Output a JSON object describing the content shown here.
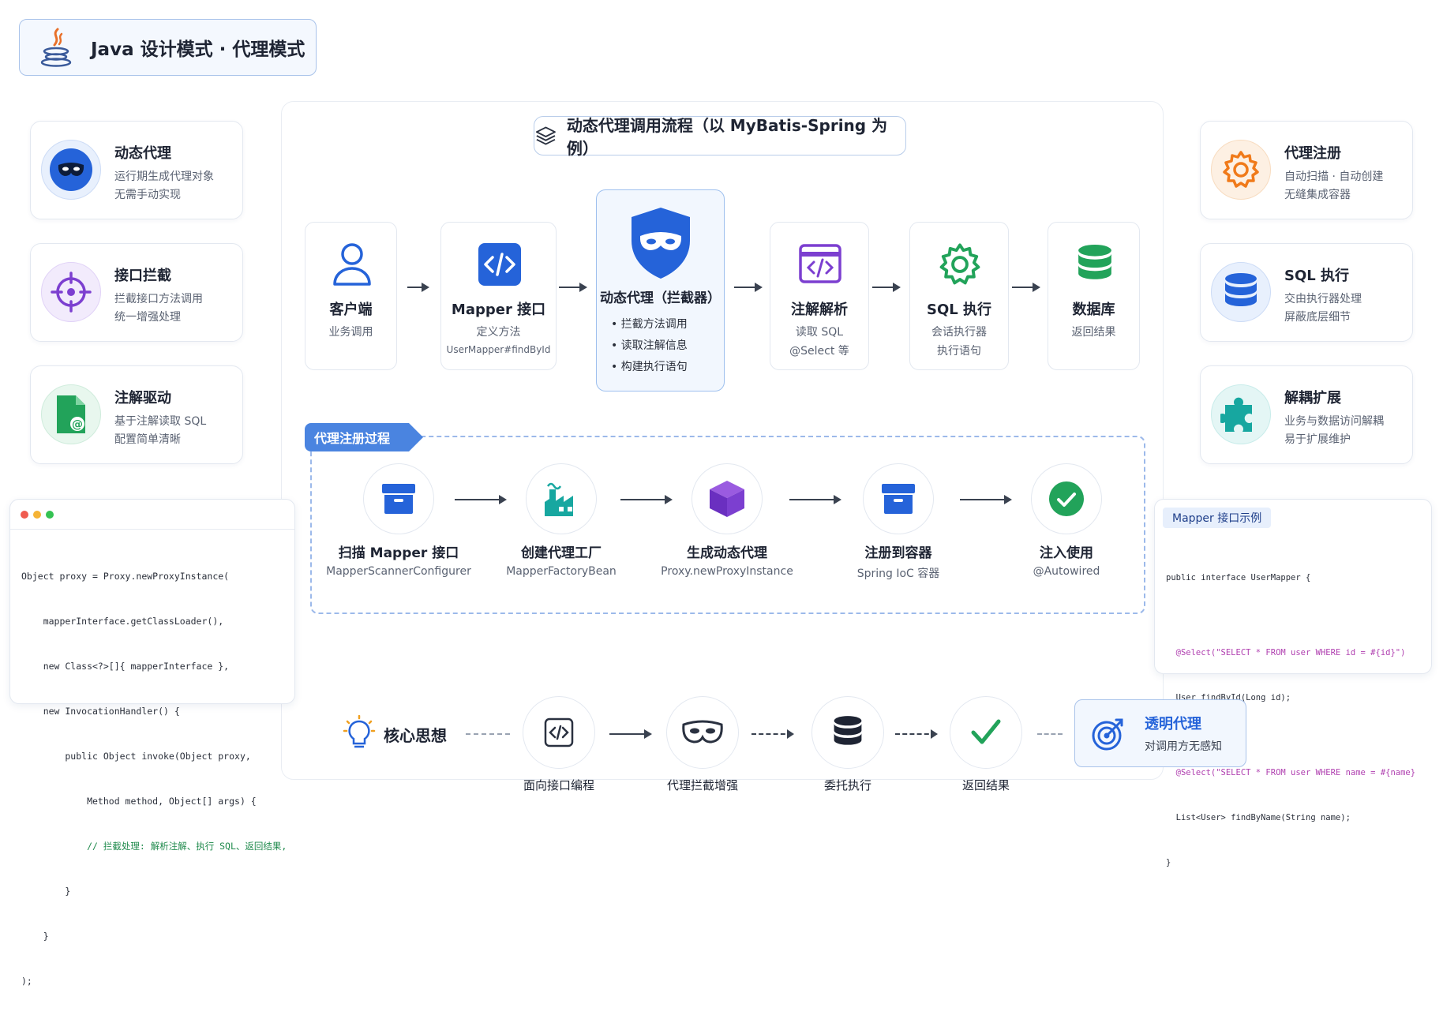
{
  "title": "Java 设计模式 · 代理模式",
  "section_title": "动态代理调用流程（以 MyBatis-Spring 为例）",
  "left_features": [
    {
      "title": "动态代理",
      "line1": "运行期生成代理对象",
      "line2": "无需手动实现",
      "icon": "mask-icon",
      "color": "#2563d9"
    },
    {
      "title": "接口拦截",
      "line1": "拦截接口方法调用",
      "line2": "统一增强处理",
      "icon": "crosshair-icon",
      "color": "#7c3fd0"
    },
    {
      "title": "注解驱动",
      "line1": "基于注解读取 SQL",
      "line2": "配置简单清晰",
      "icon": "annotation-file-icon",
      "color": "#22a35a"
    }
  ],
  "right_features": [
    {
      "title": "代理注册",
      "line1": "自动扫描 · 自动创建",
      "line2": "无缝集成容器",
      "icon": "gear-icon",
      "color": "#f07a1a"
    },
    {
      "title": "SQL 执行",
      "line1": "交由执行器处理",
      "line2": "屏蔽底层细节",
      "icon": "database-icon",
      "color": "#2563d9"
    },
    {
      "title": "解耦扩展",
      "line1": "业务与数据访问解耦",
      "line2": "易于扩展维护",
      "icon": "puzzle-icon",
      "color": "#17a7a0"
    }
  ],
  "flow": [
    {
      "title": "客户端",
      "desc": "业务调用",
      "sub": ""
    },
    {
      "title": "Mapper 接口",
      "desc": "定义方法",
      "sub": "UserMapper#findById"
    },
    {
      "title": "动态代理（拦截器）",
      "bullets": [
        "拦截方法调用",
        "读取注解信息",
        "构建执行语句"
      ]
    },
    {
      "title": "注解解析",
      "desc": "读取 SQL",
      "sub": "@Select 等"
    },
    {
      "title": "SQL 执行",
      "desc": "会话执行器",
      "sub": "执行语句"
    },
    {
      "title": "数据库",
      "desc": "返回结果",
      "sub": ""
    }
  ],
  "registration": {
    "tag": "代理注册过程",
    "steps": [
      {
        "title": "扫描 Mapper 接口",
        "desc": "MapperScannerConfigurer"
      },
      {
        "title": "创建代理工厂",
        "desc": "MapperFactoryBean"
      },
      {
        "title": "生成动态代理",
        "desc": "Proxy.newProxyInstance"
      },
      {
        "title": "注册到容器",
        "desc": "Spring IoC 容器"
      },
      {
        "title": "注入使用",
        "desc": "@Autowired"
      }
    ]
  },
  "code_left": [
    "Object proxy = Proxy.newProxyInstance(",
    "    mapperInterface.getClassLoader(),",
    "    new Class<?>[]{ mapperInterface },",
    "    new InvocationHandler() {",
    "        public Object invoke(Object proxy,",
    "            Method method, Object[] args) {",
    "            // 拦截处理: 解析注解、执行 SQL、返回结果,",
    "        }",
    "    }",
    ");"
  ],
  "code_right": {
    "label": "Mapper 接口示例",
    "lines": [
      "public interface UserMapper {",
      "",
      "  @Select(\"SELECT * FROM user WHERE id = #{id}\")",
      "  User findById(Long id);",
      "",
      "  @Select(\"SELECT * FROM user WHERE name = #{name}",
      "  List<User> findByName(String name);",
      "}"
    ]
  },
  "core": {
    "label": "核心思想",
    "steps": [
      "面向接口编程",
      "代理拦截增强",
      "委托执行",
      "返回结果"
    ],
    "highlight_title": "透明代理",
    "highlight_desc": "对调用方无感知"
  }
}
